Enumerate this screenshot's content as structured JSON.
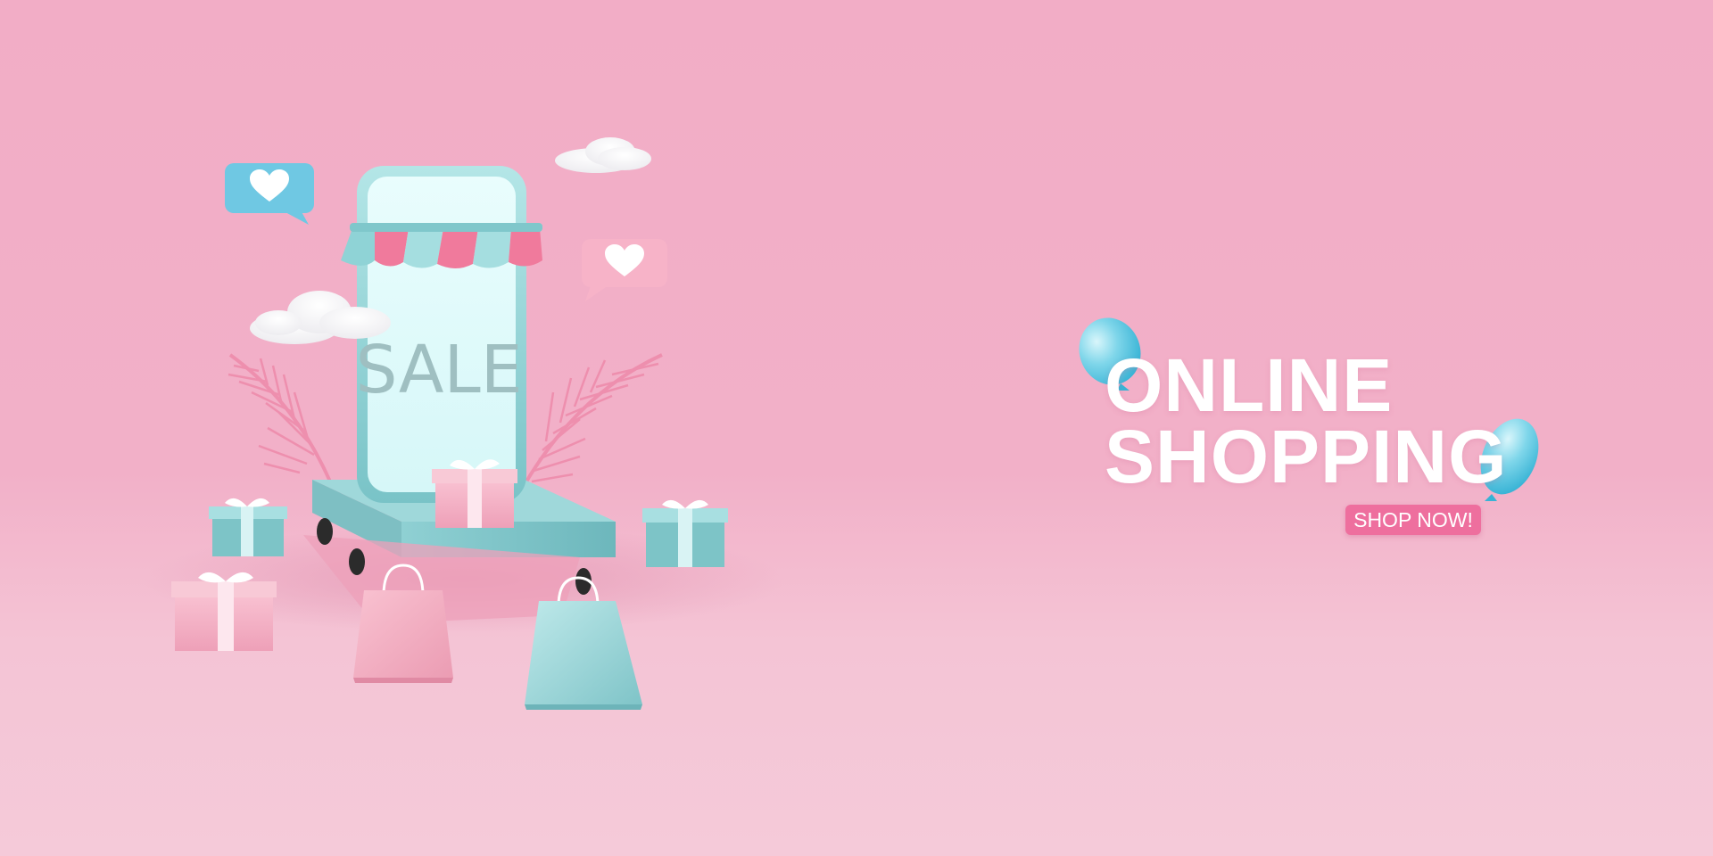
{
  "headline": {
    "line1": "ONLINE",
    "line2": "SHOPPING"
  },
  "cta": {
    "label": "SHOP NOW!",
    "color": "#ee6f9e"
  },
  "phone": {
    "screen_text": "SALE"
  },
  "colors": {
    "background": "#f2adc6",
    "teal": "#8fd3d6",
    "pink": "#f08cab",
    "white": "#ffffff"
  },
  "icons": [
    "heart-chat-bubble-icon",
    "cloud-icon",
    "palm-leaf-icon",
    "gift-box-icon",
    "shopping-bag-icon",
    "balloon-icon",
    "awning-icon"
  ]
}
